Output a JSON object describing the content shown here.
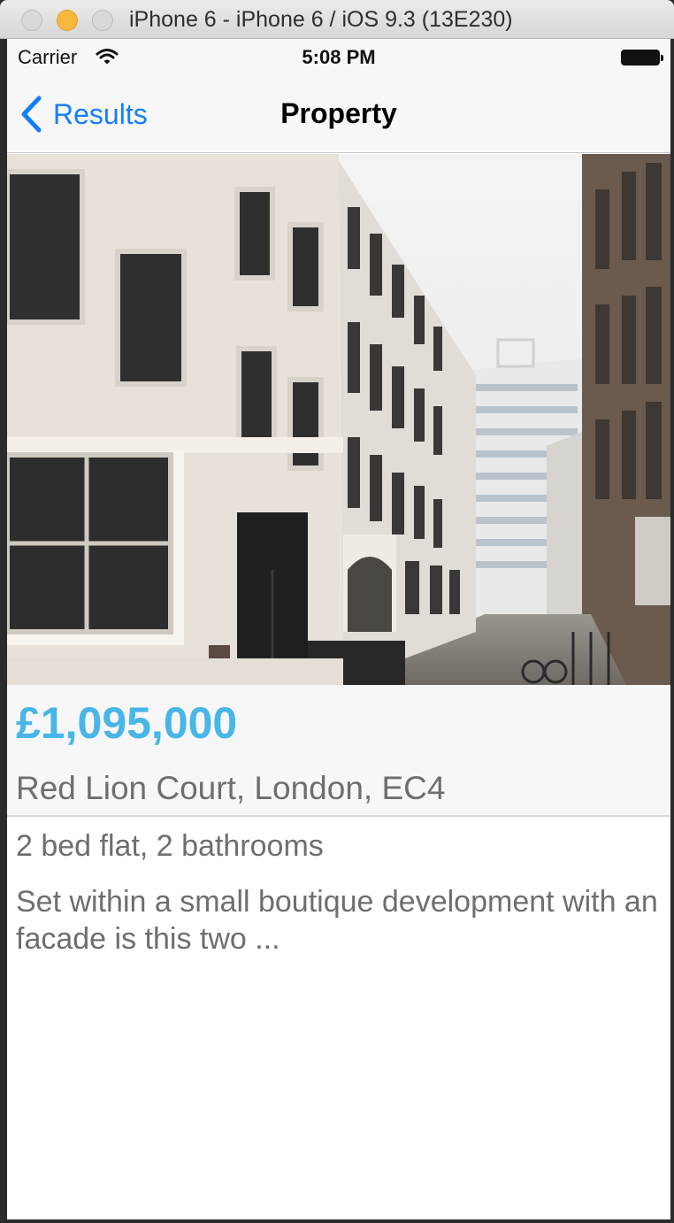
{
  "window": {
    "title": "iPhone 6 - iPhone 6 / iOS 9.3 (13E230)"
  },
  "status_bar": {
    "carrier": "Carrier",
    "time": "5:08 PM"
  },
  "nav": {
    "back_label": "Results",
    "title": "Property"
  },
  "property": {
    "price": "£1,095,000",
    "address": "Red Lion Court, London, EC4",
    "summary": "2 bed flat, 2 bathrooms",
    "description": "Set within a small boutique development with an facade is this two ..."
  },
  "colors": {
    "accent": "#157efb",
    "price": "#48b6e8",
    "secondary_text": "#6e6e6e"
  }
}
